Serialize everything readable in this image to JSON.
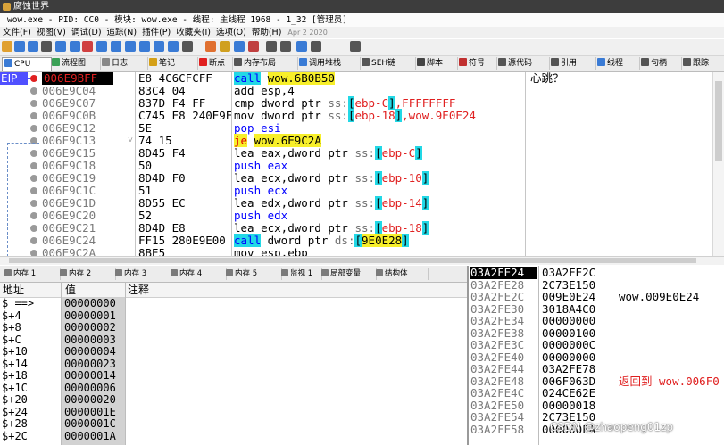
{
  "window": {
    "title": "腐蚀世界",
    "subtitle": "wow.exe - PID: CC0 - 模块: wow.exe - 线程: 主线程 1968 - 1_32 [管理员]"
  },
  "menu": {
    "items": [
      "文件(F)",
      "视图(V)",
      "调试(D)",
      "追踪(N)",
      "插件(P)",
      "收藏夹(I)",
      "选项(O)",
      "帮助(H)"
    ],
    "date": "Apr 2 2020"
  },
  "tabs": [
    {
      "label": "CPU",
      "icon": "cpu-icon",
      "color": "#3a7bd5"
    },
    {
      "label": "流程图",
      "icon": "graph-icon",
      "color": "#3aa055"
    },
    {
      "label": "日志",
      "icon": "log-icon",
      "color": "#888888"
    },
    {
      "label": "笔记",
      "icon": "notes-icon",
      "color": "#d4a017"
    },
    {
      "label": "断点",
      "icon": "breakpoint-icon",
      "color": "#e02020"
    },
    {
      "label": "内存布局",
      "icon": "memory-map-icon",
      "color": "#555555"
    },
    {
      "label": "调用堆栈",
      "icon": "callstack-icon",
      "color": "#3a7bd5"
    },
    {
      "label": "SEH链",
      "icon": "seh-icon",
      "color": "#555555"
    },
    {
      "label": "脚本",
      "icon": "script-icon",
      "color": "#444444"
    },
    {
      "label": "符号",
      "icon": "symbol-icon",
      "color": "#c03030"
    },
    {
      "label": "源代码",
      "icon": "source-icon",
      "color": "#555555"
    },
    {
      "label": "引用",
      "icon": "references-icon",
      "color": "#555555"
    },
    {
      "label": "线程",
      "icon": "threads-icon",
      "color": "#3a7bd5"
    },
    {
      "label": "句柄",
      "icon": "handles-icon",
      "color": "#555555"
    },
    {
      "label": "跟踪",
      "icon": "trace-icon",
      "color": "#555555"
    }
  ],
  "cpu": {
    "eip_label": "EIP",
    "rows": [
      {
        "addr": "006E9BFF",
        "bytes": "E8 4C6CFCFF",
        "current": true,
        "bp": true,
        "parts": [
          {
            "t": "call",
            "c": "kw-blue hl-cyan"
          },
          {
            "t": " "
          },
          {
            "t": "wow.6B0B50",
            "c": "hl-yellow"
          }
        ],
        "comment": "心跳？"
      },
      {
        "addr": "006E9C04",
        "bytes": "83C4 04",
        "parts": [
          {
            "t": "add esp,4"
          }
        ]
      },
      {
        "addr": "006E9C07",
        "bytes": "837D F4 FF",
        "parts": [
          {
            "t": "cmp dword ptr "
          },
          {
            "t": "ss:",
            "c": "seg"
          },
          {
            "t": "[",
            "c": "bracket"
          },
          {
            "t": "ebp-C",
            "c": "hl-red"
          },
          {
            "t": "]",
            "c": "bracket"
          },
          {
            "t": ",FFFFFFFF",
            "c": "hl-red"
          }
        ]
      },
      {
        "addr": "006E9C0B",
        "bytes": "C745 E8 240E9E",
        "parts": [
          {
            "t": "mov dword ptr "
          },
          {
            "t": "ss:",
            "c": "seg"
          },
          {
            "t": "[",
            "c": "bracket"
          },
          {
            "t": "ebp-18",
            "c": "hl-red"
          },
          {
            "t": "]",
            "c": "bracket"
          },
          {
            "t": ",wow.9E0E24",
            "c": "hl-red"
          }
        ]
      },
      {
        "addr": "006E9C12",
        "bytes": "5E",
        "parts": [
          {
            "t": "pop esi",
            "c": "kw-blue"
          }
        ]
      },
      {
        "addr": "006E9C13",
        "bytes": "74 15",
        "arrow": true,
        "parts": [
          {
            "t": "je",
            "c": "jmp"
          },
          {
            "t": " "
          },
          {
            "t": "wow.6E9C2A",
            "c": "hl-yellow"
          }
        ]
      },
      {
        "addr": "006E9C15",
        "bytes": "8D45 F4",
        "parts": [
          {
            "t": "lea eax,dword ptr "
          },
          {
            "t": "ss:",
            "c": "seg"
          },
          {
            "t": "[",
            "c": "bracket"
          },
          {
            "t": "ebp-C",
            "c": "hl-red"
          },
          {
            "t": "]",
            "c": "bracket"
          }
        ]
      },
      {
        "addr": "006E9C18",
        "bytes": "50",
        "parts": [
          {
            "t": "push eax",
            "c": "kw-blue"
          }
        ]
      },
      {
        "addr": "006E9C19",
        "bytes": "8D4D F0",
        "parts": [
          {
            "t": "lea ecx,dword ptr "
          },
          {
            "t": "ss:",
            "c": "seg"
          },
          {
            "t": "[",
            "c": "bracket"
          },
          {
            "t": "ebp-10",
            "c": "hl-red"
          },
          {
            "t": "]",
            "c": "bracket"
          }
        ]
      },
      {
        "addr": "006E9C1C",
        "bytes": "51",
        "parts": [
          {
            "t": "push ecx",
            "c": "kw-blue"
          }
        ]
      },
      {
        "addr": "006E9C1D",
        "bytes": "8D55 EC",
        "parts": [
          {
            "t": "lea edx,dword ptr "
          },
          {
            "t": "ss:",
            "c": "seg"
          },
          {
            "t": "[",
            "c": "bracket"
          },
          {
            "t": "ebp-14",
            "c": "hl-red"
          },
          {
            "t": "]",
            "c": "bracket"
          }
        ]
      },
      {
        "addr": "006E9C20",
        "bytes": "52",
        "parts": [
          {
            "t": "push edx",
            "c": "kw-blue"
          }
        ]
      },
      {
        "addr": "006E9C21",
        "bytes": "8D4D E8",
        "parts": [
          {
            "t": "lea ecx,dword ptr "
          },
          {
            "t": "ss:",
            "c": "seg"
          },
          {
            "t": "[",
            "c": "bracket"
          },
          {
            "t": "ebp-18",
            "c": "hl-red"
          },
          {
            "t": "]",
            "c": "bracket"
          }
        ]
      },
      {
        "addr": "006E9C24",
        "bytes": "FF15 280E9E00",
        "parts": [
          {
            "t": "call",
            "c": "kw-blue hl-cyan"
          },
          {
            "t": " dword ptr "
          },
          {
            "t": "ds:",
            "c": "seg"
          },
          {
            "t": "[",
            "c": "bracket"
          },
          {
            "t": "9E0E28",
            "c": "hl-yellow"
          },
          {
            "t": "]",
            "c": "bracket"
          }
        ]
      },
      {
        "addr": "006E9C2A",
        "bytes": "8BE5",
        "parts": [
          {
            "t": "mov esp,ebp"
          }
        ]
      }
    ]
  },
  "dump_tabs": [
    "内存 1",
    "内存 2",
    "内存 3",
    "内存 4",
    "内存 5",
    "监视 1",
    "局部变量",
    "结构体"
  ],
  "dump": {
    "headers": {
      "addr": "地址",
      "value": "值",
      "comment": "注释"
    },
    "rows": [
      {
        "a": "$ ==>",
        "v": "00000000"
      },
      {
        "a": "$+4",
        "v": "00000001"
      },
      {
        "a": "$+8",
        "v": "00000002"
      },
      {
        "a": "$+C",
        "v": "00000003"
      },
      {
        "a": "$+10",
        "v": "00000004"
      },
      {
        "a": "$+14",
        "v": "00000023"
      },
      {
        "a": "$+18",
        "v": "00000014"
      },
      {
        "a": "$+1C",
        "v": "00000006"
      },
      {
        "a": "$+20",
        "v": "00000020"
      },
      {
        "a": "$+24",
        "v": "0000001E"
      },
      {
        "a": "$+28",
        "v": "0000001C"
      },
      {
        "a": "$+2C",
        "v": "0000001A"
      }
    ]
  },
  "stack": {
    "rows": [
      {
        "a": "03A2FE24",
        "v": "03A2FE2C",
        "c": "",
        "cur": true
      },
      {
        "a": "03A2FE28",
        "v": "2C73E150",
        "c": ""
      },
      {
        "a": "03A2FE2C",
        "v": "009E0E24",
        "c": "wow.009E0E24"
      },
      {
        "a": "03A2FE30",
        "v": "3018A4C0",
        "c": ""
      },
      {
        "a": "03A2FE34",
        "v": "00000000",
        "c": ""
      },
      {
        "a": "03A2FE38",
        "v": "00000100",
        "c": ""
      },
      {
        "a": "03A2FE3C",
        "v": "0000000C",
        "c": ""
      },
      {
        "a": "03A2FE40",
        "v": "00000000",
        "c": ""
      },
      {
        "a": "03A2FE44",
        "v": "03A2FE78",
        "c": ""
      },
      {
        "a": "03A2FE48",
        "v": "006F063D",
        "c": "返回到 wow.006F0",
        "red": true
      },
      {
        "a": "03A2FE4C",
        "v": "024CE62E",
        "c": ""
      },
      {
        "a": "03A2FE50",
        "v": "00000018",
        "c": ""
      },
      {
        "a": "03A2FE54",
        "v": "2C73E150",
        "c": ""
      },
      {
        "a": "03A2FE58",
        "v": "000000FA",
        "c": ""
      }
    ]
  },
  "watermark": "CSDN @zhaopeng01zp"
}
